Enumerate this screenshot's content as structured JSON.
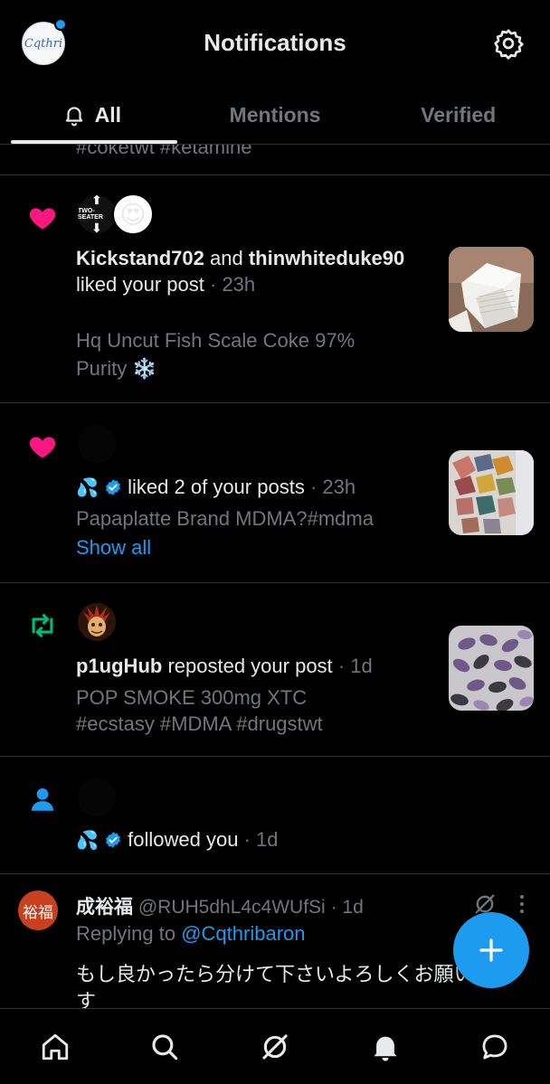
{
  "header": {
    "title": "Notifications",
    "avatar_text": "Cqthri",
    "settings_icon": "gear-icon"
  },
  "tabs": [
    {
      "label": "All",
      "active": true
    },
    {
      "label": "Mentions",
      "active": false
    },
    {
      "label": "Verified",
      "active": false
    }
  ],
  "feed": {
    "cutoff_text": "#coketwt #ketamine",
    "notifications": [
      {
        "type": "like",
        "icon": "heart-icon",
        "avatar1_text": "TWO-SEATER",
        "avatar2_emoji": "😍",
        "user1": "Kickstand702",
        "connector": "and",
        "user2": "thinwhiteduke90",
        "action": "liked your post",
        "time": "23h",
        "preview_line1": "Hq Uncut Fish Scale Coke 97%",
        "preview_line2": "Purity",
        "preview_emoji": "❄️"
      },
      {
        "type": "like",
        "icon": "heart-icon",
        "user_emoji": "💦",
        "action": "liked 2 of your posts",
        "time": "23h",
        "preview": "Papaplatte Brand MDMA?#mdma",
        "show_all": "Show all"
      },
      {
        "type": "repost",
        "icon": "repost-icon",
        "user": "p1ugHub",
        "action": "reposted your post",
        "time": "1d",
        "preview_line1": "POP SMOKE 300mg XTC",
        "preview_line2": "#ecstasy #MDMA #drugstwt"
      },
      {
        "type": "follow",
        "icon": "person-icon",
        "user_emoji": "💦",
        "action": "followed you",
        "time": "1d"
      }
    ],
    "reply": {
      "avatar_text": "裕福",
      "display_name": "成裕福",
      "handle": "@RUH5dhL4c4WUfSi",
      "time": "1d",
      "replying_prefix": "Replying to",
      "replying_to": "@Cqthribaron",
      "body": "もし良かったら分けて下さいよろしくお願いします"
    }
  },
  "separator": "·",
  "fab_icon": "plus-icon",
  "bottom_nav": [
    "home-icon",
    "search-icon",
    "grok-icon",
    "notifications-icon",
    "messages-icon"
  ],
  "colors": {
    "accent": "#1d9bf0",
    "like": "#f91880",
    "repost": "#00ba7c",
    "muted": "#71767b",
    "background": "#000000"
  }
}
